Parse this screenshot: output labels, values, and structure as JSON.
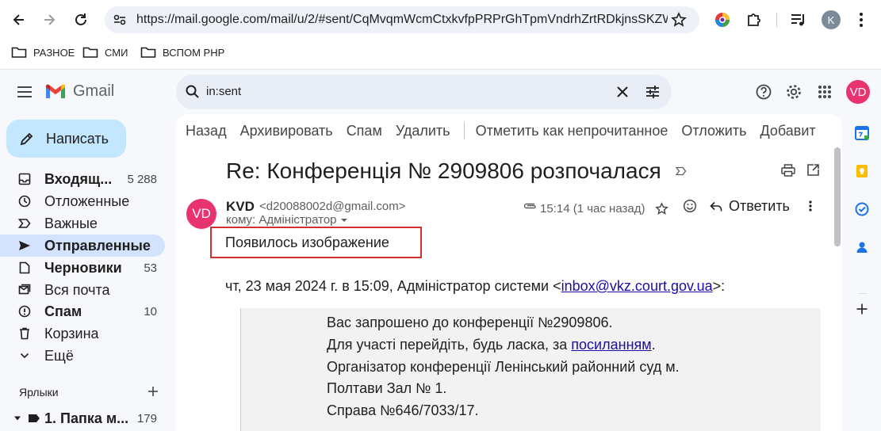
{
  "browser": {
    "url": "https://mail.google.com/mail/u/2/#sent/CqMvqmWcmCtxkvfpPRPrGhTpmVndrhZrtRDkjnsSKZWzR...",
    "profile_initial": "K",
    "bookmarks": [
      "РАЗНОЕ",
      "СМИ",
      "ВСПОМ PHP"
    ]
  },
  "gmail": {
    "logo_text": "Gmail",
    "search_value": "in:sent",
    "account_initials": "VD",
    "compose_label": "Написать",
    "nav": [
      {
        "label": "Входящ...",
        "count": "5 288",
        "icon": "inbox-icon",
        "bold": true
      },
      {
        "label": "Отложенные",
        "count": "",
        "icon": "clock-icon",
        "bold": false
      },
      {
        "label": "Важные",
        "count": "",
        "icon": "important-icon",
        "bold": false
      },
      {
        "label": "Отправленные",
        "count": "",
        "icon": "send-icon",
        "bold": true,
        "active": true
      },
      {
        "label": "Черновики",
        "count": "53",
        "icon": "draft-icon",
        "bold": true
      },
      {
        "label": "Вся почта",
        "count": "",
        "icon": "all-mail-icon",
        "bold": false
      },
      {
        "label": "Спам",
        "count": "10",
        "icon": "spam-icon",
        "bold": true
      },
      {
        "label": "Корзина",
        "count": "",
        "icon": "trash-icon",
        "bold": false
      },
      {
        "label": "Ещё",
        "count": "",
        "icon": "chevron-down-icon",
        "bold": false
      }
    ],
    "labels_heading": "Ярлыки",
    "label_item": {
      "label": "1. Папка м...",
      "count": "179"
    }
  },
  "toolbar": {
    "back": "Назад",
    "archive": "Архивировать",
    "spam": "Спам",
    "delete": "Удалить",
    "mark_unread": "Отметить как непрочитанное",
    "snooze": "Отложить",
    "add": "Добавит"
  },
  "message": {
    "subject": "Re: Конференція № 2909806 розпочалася",
    "sender_initials": "VD",
    "sender_name": "KVD",
    "sender_email": "<d20088002d@gmail.com>",
    "to_line": "кому: Адміністратор",
    "time": "15:14 (1 час назад)",
    "reply_label": "Ответить",
    "body_text": "Появилось изображение",
    "quote_header_prefix": "чт, 23 мая 2024 г. в 15:09, Адміністратор системи <",
    "quote_header_link": "inbox@vkz.court.gov.ua",
    "quote_header_suffix": ">:",
    "quote_lines": [
      "Вас запрошено до конференції №2909806.",
      "Для участі перейдіть, будь ласка, за ",
      "Організатор конференції Ленінський районний суд м.",
      "Полтави Зал № 1.",
      "Справа №646/7033/17."
    ],
    "quote_link": "посиланням",
    "quote_link_suffix": "."
  },
  "colors": {
    "accent_red": "#d32f2f",
    "avatar_pink": "#e8336f",
    "active_nav": "#d3e3fd",
    "compose_bg": "#c2e7ff"
  }
}
